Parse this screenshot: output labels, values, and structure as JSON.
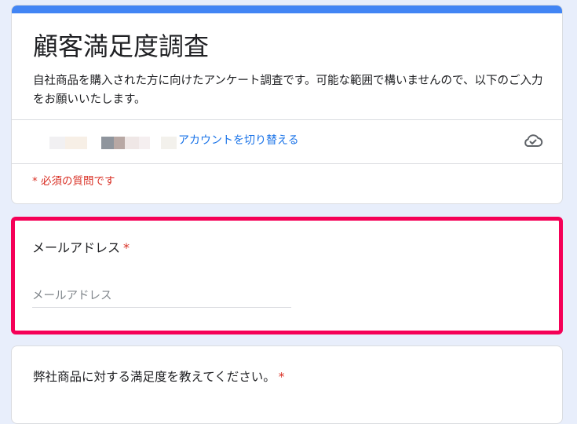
{
  "form": {
    "title": "顧客満足度調査",
    "description": "自社商品を購入された方に向けたアンケート調査です。可能な範囲で構いませんので、以下のご入力をお願いいたします。",
    "switch_account_label": "アカウントを切り替える",
    "cloud_icon": "cloud-saved-icon",
    "required_note": "* 必須の質問です"
  },
  "questions": [
    {
      "label": "メールアドレス",
      "required_mark": "*",
      "placeholder": "メールアドレス",
      "value": ""
    },
    {
      "label": "弊社商品に対する満足度を教えてください。",
      "required_mark": "*"
    }
  ],
  "colors": {
    "accent_bar": "#4285f4",
    "link": "#1a73e8",
    "required": "#d93025",
    "highlight_border": "#f50057",
    "background": "#e8eefb"
  }
}
